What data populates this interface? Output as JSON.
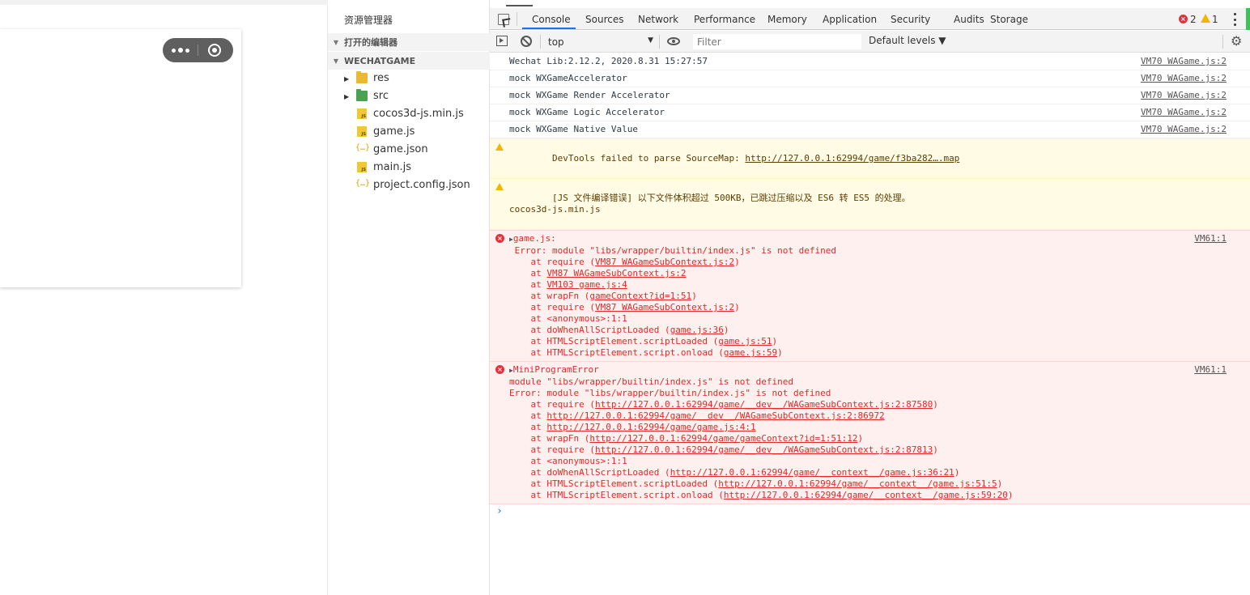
{
  "explorer": {
    "title": "资源管理器",
    "open_editors": "打开的编辑器",
    "project": "WECHATGAME",
    "files": [
      {
        "name": "res",
        "type": "folder"
      },
      {
        "name": "src",
        "type": "folder-src"
      },
      {
        "name": "cocos3d-js.min.js",
        "type": "js"
      },
      {
        "name": "game.js",
        "type": "js"
      },
      {
        "name": "game.json",
        "type": "json"
      },
      {
        "name": "main.js",
        "type": "js"
      },
      {
        "name": "project.config.json",
        "type": "json"
      }
    ]
  },
  "devtools": {
    "tabs": [
      "Console",
      "Sources",
      "Network",
      "Performance",
      "Memory",
      "Application",
      "Security",
      "Audits",
      "Storage"
    ],
    "active_tab": "Console",
    "error_count": "2",
    "warning_count": "1",
    "context": "top",
    "filter_placeholder": "Filter",
    "levels": "Default levels ▼"
  },
  "console": {
    "logs": [
      {
        "text": "Wechat Lib:2.12.2, 2020.8.31 15:27:57",
        "src": "VM70 WAGame.js:2"
      },
      {
        "text": "mock WXGameAccelerator",
        "src": "VM70 WAGame.js:2"
      },
      {
        "text": "mock WXGame Render Accelerator",
        "src": "VM70 WAGame.js:2"
      },
      {
        "text": "mock WXGame Logic Accelerator",
        "src": "VM70 WAGame.js:2"
      },
      {
        "text": "mock WXGame Native Value",
        "src": "VM70 WAGame.js:2"
      }
    ],
    "warn1_prefix": "DevTools failed to parse SourceMap: ",
    "warn1_link": "http://127.0.0.1:62994/game/f3ba282….map",
    "warn2_line1": "[JS 文件编译错误] 以下文件体积超过 500KB，已跳过压缩以及 ES6 转 ES5 的处理。",
    "warn2_line2": "cocos3d-js.min.js",
    "err1": {
      "head": "game.js:",
      "src": "VM61:1",
      "message": " Error: module \"libs/wrapper/builtin/index.js\" is not defined",
      "stack": [
        {
          "pre": "    at require (",
          "link": "VM87 WAGameSubContext.js:2",
          "post": ")"
        },
        {
          "pre": "    at ",
          "link": "VM87 WAGameSubContext.js:2",
          "post": ""
        },
        {
          "pre": "    at ",
          "link": "VM103 game.js:4",
          "post": ""
        },
        {
          "pre": "    at wrapFn (",
          "link": "gameContext?id=1:51",
          "post": ")"
        },
        {
          "pre": "    at require (",
          "link": "VM87 WAGameSubContext.js:2",
          "post": ")"
        },
        {
          "pre": "    at <anonymous>:1:1",
          "link": "",
          "post": ""
        },
        {
          "pre": "    at doWhenAllScriptLoaded (",
          "link": "game.js:36",
          "post": ")"
        },
        {
          "pre": "    at HTMLScriptElement.scriptLoaded (",
          "link": "game.js:51",
          "post": ")"
        },
        {
          "pre": "    at HTMLScriptElement.script.onload (",
          "link": "game.js:59",
          "post": ")"
        }
      ]
    },
    "err2": {
      "head": "MiniProgramError",
      "src": "VM61:1",
      "line1": "module \"libs/wrapper/builtin/index.js\" is not defined",
      "line2": "Error: module \"libs/wrapper/builtin/index.js\" is not defined",
      "stack": [
        {
          "pre": "    at require (",
          "link": "http://127.0.0.1:62994/game/__dev__/WAGameSubContext.js:2:87580",
          "post": ")"
        },
        {
          "pre": "    at ",
          "link": "http://127.0.0.1:62994/game/__dev__/WAGameSubContext.js:2:86972",
          "post": ""
        },
        {
          "pre": "    at ",
          "link": "http://127.0.0.1:62994/game/game.js:4:1",
          "post": ""
        },
        {
          "pre": "    at wrapFn (",
          "link": "http://127.0.0.1:62994/game/gameContext?id=1:51:12",
          "post": ")"
        },
        {
          "pre": "    at require (",
          "link": "http://127.0.0.1:62994/game/__dev__/WAGameSubContext.js:2:87813",
          "post": ")"
        },
        {
          "pre": "    at <anonymous>:1:1",
          "link": "",
          "post": ""
        },
        {
          "pre": "    at doWhenAllScriptLoaded (",
          "link": "http://127.0.0.1:62994/game/__context__/game.js:36:21",
          "post": ")"
        },
        {
          "pre": "    at HTMLScriptElement.scriptLoaded (",
          "link": "http://127.0.0.1:62994/game/__context__/game.js:51:5",
          "post": ")"
        },
        {
          "pre": "    at HTMLScriptElement.script.onload (",
          "link": "http://127.0.0.1:62994/game/__context__/game.js:59:20",
          "post": ")"
        }
      ]
    },
    "prompt": "›"
  },
  "colors": {
    "accent": "#1a73e8",
    "error": "#e02a2a",
    "warning": "#f4b400",
    "capsule": "#5f5f5f"
  },
  "icons": [
    "inspect-icon",
    "sidebar-toggle-icon",
    "clear-icon",
    "eye-icon",
    "gear-icon",
    "more-icon",
    "capsule-menu-icon",
    "capsule-close-icon"
  ]
}
